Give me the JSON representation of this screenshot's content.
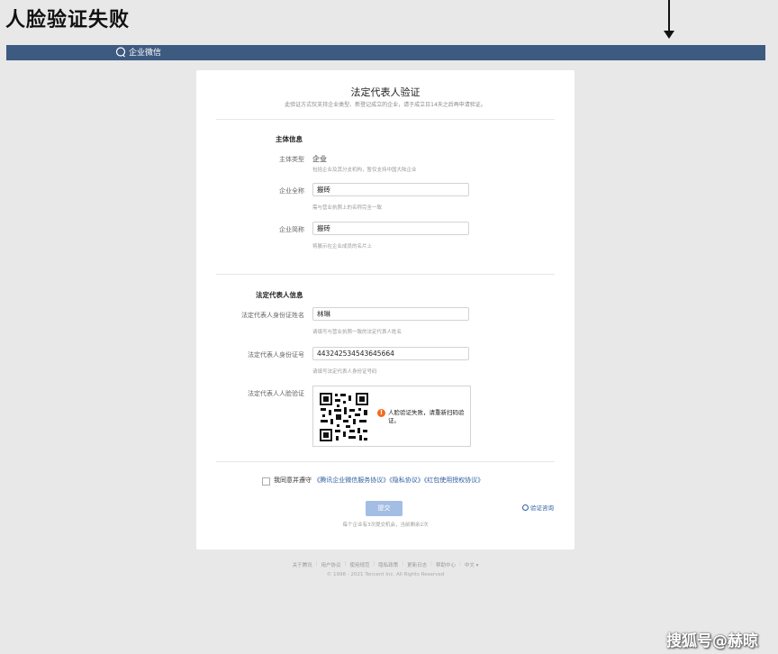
{
  "page_heading": "人脸验证失败",
  "topbar": {
    "brand": "企业微信"
  },
  "card": {
    "title": "法定代表人验证",
    "subtitle": "此验证方式仅支持企业类型、新登记成立的企业，请于成立日14天之后再申请验证。"
  },
  "subject_info": {
    "section_title": "主体信息",
    "type_label": "主体类型",
    "type_value": "企业",
    "type_hint": "包括企业及其分支机构，暂仅支持中国大陆企业",
    "fullname_label": "企业全称",
    "fullname_value": "搬砖",
    "fullname_hint": "需与营业执照上的名称完全一致",
    "shortname_label": "企业简称",
    "shortname_value": "搬砖",
    "shortname_hint": "将展示在企业成员的名片上"
  },
  "legal_rep": {
    "section_title": "法定代表人信息",
    "name_label": "法定代表人身份证姓名",
    "name_value": "林琳",
    "name_hint": "请填写与营业执照一致的法定代表人姓名",
    "id_label": "法定代表人身份证号",
    "id_value": "443242534543645664",
    "id_hint": "请填写法定代表人身份证号码",
    "face_label": "法定代表人人脸验证",
    "face_warning": "人脸验证失败，请重新扫码验证。"
  },
  "agreement": {
    "prefix": "我同意并遵守",
    "link1": "《腾讯企业微信服务协议》",
    "link2": "《隐私协议》",
    "link3": "《红包使用授权协议》"
  },
  "submit_label": "提交",
  "consult_label": "验证咨询",
  "remaining_text": "每个企业有3次提交机会，当前剩余2次",
  "footer": {
    "links": [
      "关于腾讯",
      "用户协议",
      "使用规范",
      "隐私政策",
      "更新日志",
      "帮助中心",
      "中文 ▾"
    ],
    "copyright": "© 1998 - 2021 Tencent Inc. All Rights Reserved"
  },
  "watermark": "搜狐号@赫晾",
  "colors": {
    "topbar": "#3d5a80",
    "link": "#2f5d9e",
    "submit_disabled": "#a4bde4",
    "warning": "#f26b21"
  },
  "icons": {
    "brand": "chat-bubble-icon",
    "warning": "exclamation-circle-icon",
    "consult": "help-circle-icon"
  }
}
